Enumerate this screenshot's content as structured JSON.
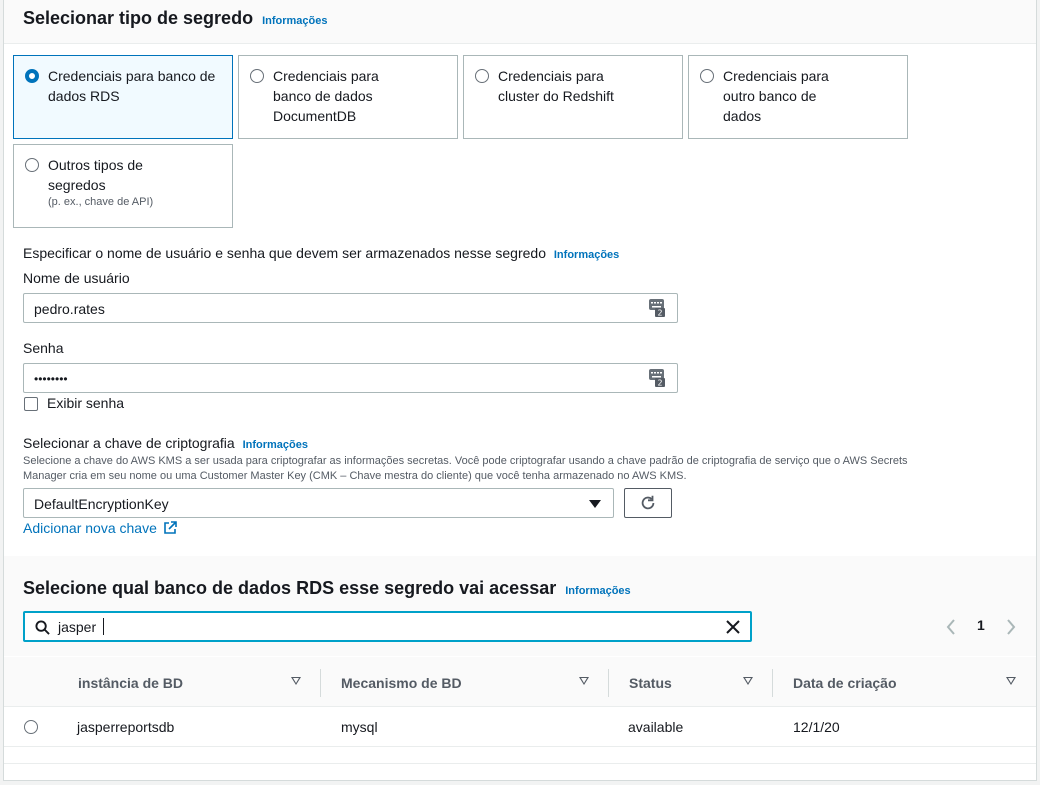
{
  "section1": {
    "title": "Selecionar tipo de segredo",
    "info": "Informações",
    "tiles": [
      {
        "label": "Credenciais para banco de dados RDS",
        "desc": ""
      },
      {
        "label": "Credenciais para banco de dados DocumentDB",
        "desc": ""
      },
      {
        "label": "Credenciais para cluster do Redshift",
        "desc": ""
      },
      {
        "label": "Credenciais para outro banco de dados",
        "desc": ""
      },
      {
        "label": "Outros tipos de segredos",
        "desc": "(p. ex., chave de API)"
      }
    ],
    "selected_tile": 0
  },
  "credentials": {
    "heading": "Especificar o nome de usuário e senha que devem ser armazenados nesse segredo",
    "info": "Informações",
    "username_label": "Nome de usuário",
    "username_value": "pedro.rates",
    "password_label": "Senha",
    "password_value": "••••••••",
    "show_password_label": "Exibir senha",
    "show_password_checked": false
  },
  "encryption": {
    "label": "Selecionar a chave de criptografia",
    "info": "Informações",
    "description_line1": "Selecione a chave do AWS KMS a ser usada para criptografar as informações secretas. Você pode criptografar usando a chave padrão de criptografia de serviço que o AWS Secrets",
    "description_line2": "Manager cria em seu nome ou uma Customer Master Key (CMK – Chave mestra do cliente) que você tenha armazenado no AWS KMS.",
    "selected_key": "DefaultEncryptionKey",
    "add_key_link": "Adicionar nova chave"
  },
  "database": {
    "title": "Selecione qual banco de dados RDS esse segredo vai acessar",
    "info": "Informações",
    "search_value": "jasper",
    "page": "1",
    "columns": [
      "instância de BD",
      "Mecanismo de BD",
      "Status",
      "Data de criação"
    ],
    "rows": [
      {
        "instance": "jasperreportsdb",
        "engine": "mysql",
        "status": "available",
        "created": "12/1/20"
      }
    ]
  },
  "icons": {
    "keyboard": "keyboard-icon",
    "refresh": "refresh-icon",
    "external": "external-link-icon",
    "search": "search-icon",
    "clear": "close-icon"
  },
  "colors": {
    "accent": "#0073bb",
    "focus": "#00a1c9"
  }
}
